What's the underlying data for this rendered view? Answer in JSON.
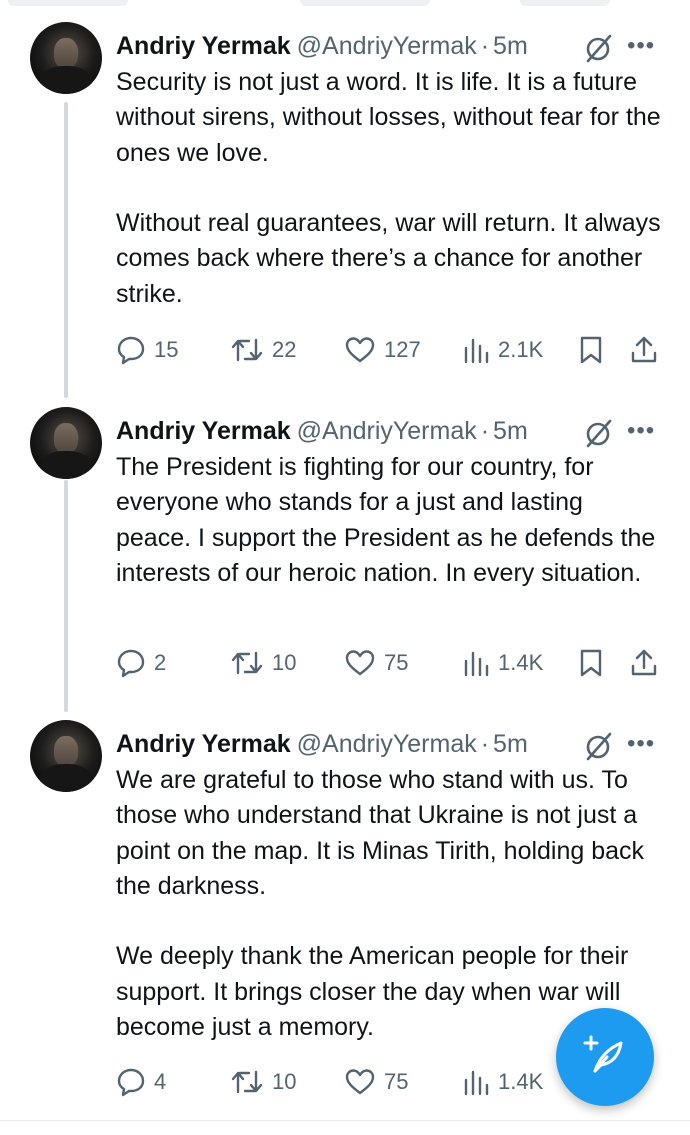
{
  "thread": {
    "tweets": [
      {
        "author": {
          "name": "Andriy Yermak",
          "handle": "@AndriyYermak"
        },
        "separator": "·",
        "time": "5m",
        "text": "Security is not just a word. It is life. It is a future without sirens, without losses, without fear for the ones we love.\n\nWithout real guarantees, war will return. It always comes back where there’s a chance for another strike.",
        "stats": {
          "replies": "15",
          "reposts": "22",
          "likes": "127",
          "views": "2.1K"
        }
      },
      {
        "author": {
          "name": "Andriy Yermak",
          "handle": "@AndriyYermak"
        },
        "separator": "·",
        "time": "5m",
        "text": "The President is fighting for our country, for everyone who stands for a just and lasting peace. I support the President as he defends the interests of our heroic nation. In every situation.",
        "stats": {
          "replies": "2",
          "reposts": "10",
          "likes": "75",
          "views": "1.4K"
        }
      },
      {
        "author": {
          "name": "Andriy Yermak",
          "handle": "@AndriyYermak"
        },
        "separator": "·",
        "time": "5m",
        "text": "We are grateful to those who stand with us. To those who understand that Ukraine is not just a point on the map. It is Minas Tirith, holding back the darkness.\n\nWe deeply thank the American people for their support. It brings closer the day when war will become just a memory.",
        "stats": {
          "replies": "4",
          "reposts": "10",
          "likes": "75",
          "views": "1.4K"
        }
      }
    ]
  },
  "icons": {
    "reply": "reply-icon",
    "repost": "repost-icon",
    "like": "heart-icon",
    "views": "views-icon",
    "bookmark": "bookmark-icon",
    "share": "share-icon",
    "grok": "grok-icon",
    "more": "more-icon",
    "compose": "compose-icon"
  },
  "colors": {
    "accent": "#1d9bf0",
    "text": "#0f1419",
    "muted": "#536471",
    "thread_line": "#cfd9de"
  }
}
